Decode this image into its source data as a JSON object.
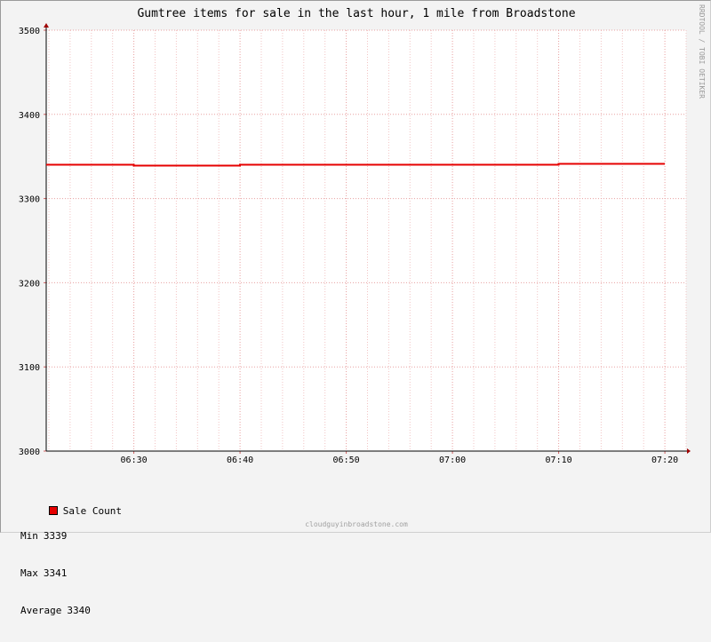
{
  "chart_data": {
    "type": "line",
    "title": "Gumtree items for sale in the last hour, 1 mile from Broadstone",
    "xlabel": "",
    "ylabel": "",
    "x_ticks": [
      "06:30",
      "06:40",
      "06:50",
      "07:00",
      "07:10",
      "07:20"
    ],
    "y_ticks": [
      "3000",
      "3100",
      "3200",
      "3300",
      "3400",
      "3500"
    ],
    "ylim": [
      3000,
      3500
    ],
    "xlim": [
      "06:21:45",
      "07:22:00"
    ],
    "grid": true,
    "legend_position": "bottom-left",
    "series": [
      {
        "name": "Sale Count",
        "color": "#e60000",
        "points": [
          {
            "x": "06:21:45",
            "y": 3340
          },
          {
            "x": "06:30:00",
            "y": 3340
          },
          {
            "x": "06:30:00",
            "y": 3339
          },
          {
            "x": "06:40:00",
            "y": 3339
          },
          {
            "x": "06:40:00",
            "y": 3340
          },
          {
            "x": "07:10:00",
            "y": 3340
          },
          {
            "x": "07:10:00",
            "y": 3341
          },
          {
            "x": "07:20:00",
            "y": 3341
          }
        ]
      }
    ]
  },
  "legend": {
    "series_label": "Sale Count",
    "swatch_color": "#e60000",
    "min_label": "Min",
    "min_value": "3339",
    "max_label": "Max",
    "max_value": "3341",
    "avg_label": "Average",
    "avg_value": "3340"
  },
  "watermark": "RRDTOOL / TOBI OETIKER",
  "footer": "cloudguyinbroadstone.com"
}
